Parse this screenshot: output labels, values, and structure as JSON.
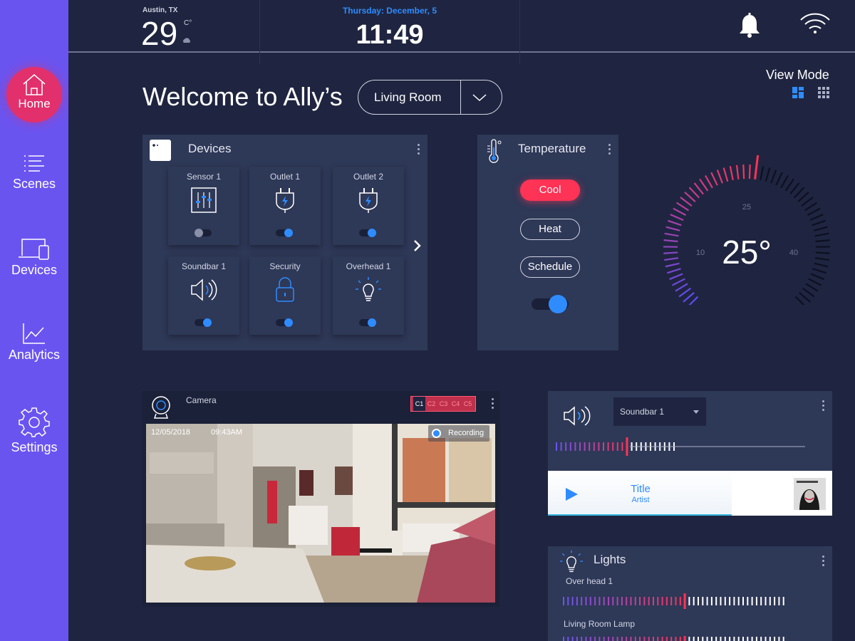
{
  "sidebar": {
    "items": [
      {
        "label": "Home",
        "icon": "home-icon"
      },
      {
        "label": "Scenes",
        "icon": "list-icon"
      },
      {
        "label": "Devices",
        "icon": "devices-icon"
      },
      {
        "label": "Analytics",
        "icon": "chart-icon"
      },
      {
        "label": "Settings",
        "icon": "gear-icon"
      }
    ]
  },
  "topbar": {
    "location": "Austin, TX",
    "temperature": "29",
    "unit": "C°",
    "date": "Thursday: December, 5",
    "time": "11:49"
  },
  "header": {
    "welcome": "Welcome to Ally’s",
    "room": "Living Room",
    "view_mode": "View Mode"
  },
  "devices": {
    "title": "Devices",
    "tiles": [
      {
        "name": "Sensor 1",
        "icon": "sliders-icon",
        "on": false
      },
      {
        "name": "Outlet 1",
        "icon": "plug-icon",
        "on": true
      },
      {
        "name": "Outlet 2",
        "icon": "plug-icon",
        "on": true
      },
      {
        "name": "Soundbar 1",
        "icon": "speaker-icon",
        "on": true
      },
      {
        "name": "Security",
        "icon": "lock-icon",
        "on": true
      },
      {
        "name": "Overhead 1",
        "icon": "bulb-icon",
        "on": true
      }
    ]
  },
  "temperature": {
    "title": "Temperature",
    "modes": [
      "Cool",
      "Heat",
      "Schedule"
    ],
    "active_mode": "Cool",
    "enabled": true,
    "dial_value": "25°",
    "dial_min": "10",
    "dial_mid": "25",
    "dial_max": "40"
  },
  "camera": {
    "title": "Camera",
    "tabs": [
      "C1",
      "C2",
      "C3",
      "C4",
      "C5"
    ],
    "active_tab": "C1",
    "date": "12/05/2018",
    "time": "09:43AM",
    "status": "Recording"
  },
  "soundbar": {
    "device": "Soundbar 1",
    "volume_fraction": 0.61,
    "track_title": "Title",
    "track_artist": "Artist"
  },
  "lights": {
    "title": "Lights",
    "items": [
      {
        "name": "Over head 1",
        "level_fraction": 0.55
      },
      {
        "name": "Living Room Lamp",
        "level_fraction": 0.55
      }
    ]
  },
  "colors": {
    "sidebar": "#6a54f0",
    "accent_blue": "#2f8cff",
    "accent_red": "#ff3355",
    "background": "#1f2540",
    "card": "#2e3857"
  }
}
